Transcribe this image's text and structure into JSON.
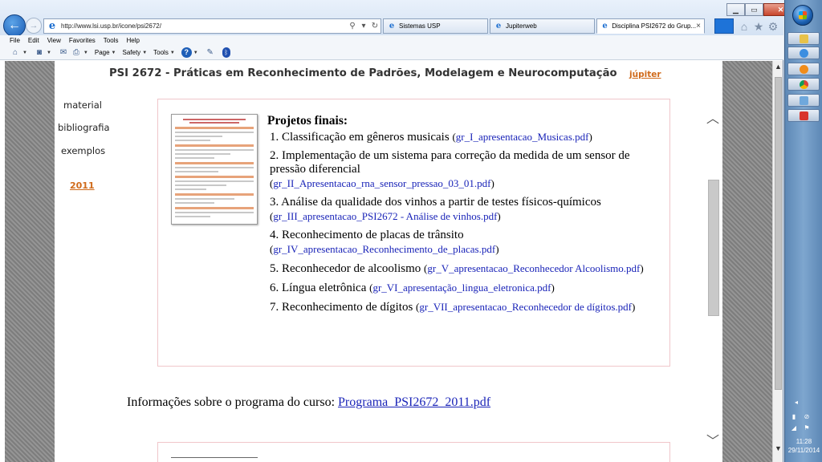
{
  "browser": {
    "url": "http://www.lsi.usp.br/icone/psi2672/",
    "tabs": [
      {
        "label": "Sistemas USP",
        "active": false
      },
      {
        "label": "Jupiterweb",
        "active": false
      },
      {
        "label": "Disciplina PSI2672 do Grup...",
        "active": true
      }
    ],
    "close_glyph": "×",
    "window_controls": {
      "minimize": "▁",
      "maximize": "▭",
      "close": "✕"
    },
    "menus": [
      "File",
      "Edit",
      "View",
      "Favorites",
      "Tools",
      "Help"
    ],
    "commands": {
      "page": "Page",
      "safety": "Safety",
      "tools": "Tools"
    },
    "icons": [
      "back-arrow-icon",
      "forward-arrow-icon",
      "ie-icon",
      "search-icon",
      "refresh-icon",
      "home-icon",
      "star-icon",
      "gear-icon",
      "feeds-icon",
      "print-icon",
      "help-icon",
      "bluetooth-icon"
    ]
  },
  "page": {
    "title": "PSI 2672 - Práticas em Reconhecimento de Padrões, Modelagem e Neurocomputação",
    "jupiter_link": "júpiter",
    "sidebar": {
      "material": "material",
      "bibliografia": "bibliografia",
      "exemplos": "exemplos",
      "year": "2011"
    },
    "projects": {
      "heading": "Projetos finais:",
      "items": [
        {
          "text": "1. Classificação em gêneros musicais",
          "file": "gr_I_apresentacao_Musicas.pdf"
        },
        {
          "text": "2. Implementação de um sistema para correção da medida de um sensor de pressão diferencial",
          "file": "gr_II_Apresentacao_rna_sensor_pressao_03_01.pdf"
        },
        {
          "text": "3. Análise da qualidade dos vinhos a partir de testes físicos-químicos",
          "file": "gr_III_apresentacao_PSI2672 - Análise de vinhos.pdf"
        },
        {
          "text": "4. Reconhecimento de placas de trânsito",
          "file": "gr_IV_apresentacao_Reconhecimento_de_placas.pdf"
        },
        {
          "text": "5. Reconhecedor de alcoolismo",
          "file": "gr_V_apresentacao_Reconhecedor Alcoolismo.pdf"
        },
        {
          "text": "6. Língua eletrônica",
          "file": "gr_VI_apresentação_lingua_eletronica.pdf"
        },
        {
          "text": "7. Reconhecimento de dígitos",
          "file": "gr_VII_apresentacao_Reconhecedor de dígitos.pdf"
        }
      ]
    },
    "program_info": {
      "text": "Informações sobre o programa do curso: ",
      "link": "Programa_PSI2672_2011.pdf"
    }
  },
  "taskbar": {
    "clock_time": "11:28",
    "clock_date": "29/11/2014"
  }
}
